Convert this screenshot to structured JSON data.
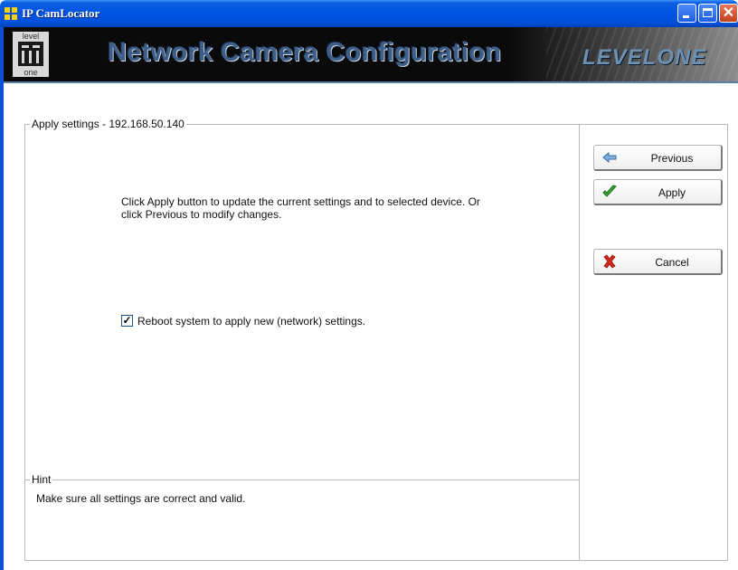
{
  "window": {
    "title": "IP CamLocator",
    "controls": {
      "minimize": "minimize",
      "maximize": "maximize",
      "close": "✕"
    }
  },
  "banner": {
    "logo_top": "level",
    "logo_bottom": "one",
    "title": "Network Camera Configuration",
    "brand": "LEVELONE"
  },
  "apply_panel": {
    "legend": "Apply settings - 192.168.50.140",
    "info": "Click Apply button to update the current settings and to selected device. Or click Previous to modify changes.",
    "reboot_checkbox": {
      "checked": true,
      "label": "Reboot system to apply  new (network) settings."
    }
  },
  "hint_panel": {
    "legend": "Hint",
    "text": "Make sure all settings are correct and valid."
  },
  "buttons": {
    "previous": {
      "label": "Previous",
      "icon": "left-arrow-icon"
    },
    "apply": {
      "label": "Apply",
      "icon": "checkmark-icon"
    },
    "cancel": {
      "label": "Cancel",
      "icon": "x-mark-icon"
    }
  },
  "colors": {
    "titlebar": "#0054e3",
    "banner_bg": "#0a0a0a",
    "banner_title": "#3e5f8a",
    "check_green": "#2e9a2e",
    "cancel_red": "#d62a1f",
    "prev_blue": "#5b9bd5"
  }
}
